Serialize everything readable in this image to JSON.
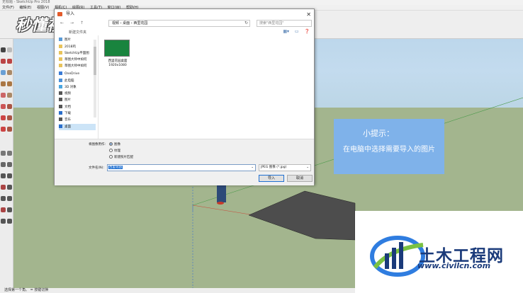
{
  "app": {
    "title": "无标题 - SketchUp Pro 2018",
    "menus": [
      "文件(F)",
      "编辑(E)",
      "视图(V)",
      "相机(C)",
      "绘图(R)",
      "工具(T)",
      "窗口(W)",
      "帮助(H)"
    ],
    "status": "选择第一个角。 = 按键切换"
  },
  "watermark": {
    "logo_text": "秒懂视频"
  },
  "dialog": {
    "title": "导入",
    "close_glyph": "✕",
    "nav": {
      "back": "←",
      "forward": "→",
      "up": "↑"
    },
    "address": "视频 › 桌面 › 西里花园",
    "search_placeholder": "搜索\"西里花园\"",
    "new_folder": "新建文件夹",
    "sidebar": [
      {
        "label": "图片",
        "icon": "pictures-icon",
        "color": "#5a9ad6"
      },
      {
        "label": "2018鸡",
        "icon": "folder-icon",
        "color": "#e8c35a"
      },
      {
        "label": "SketchUp平面图",
        "icon": "folder-icon",
        "color": "#e8c35a"
      },
      {
        "label": "草图大师中如何",
        "icon": "folder-icon",
        "color": "#e8c35a"
      },
      {
        "label": "草图大师中如何",
        "icon": "folder-icon",
        "color": "#e8c35a"
      },
      {
        "label": "OneDrive",
        "icon": "cloud-icon",
        "color": "#3a7bd5"
      },
      {
        "label": "此电脑",
        "icon": "computer-icon",
        "color": "#4a90d9"
      },
      {
        "label": "3D 对象",
        "icon": "3d-objects-icon",
        "color": "#4aa6e0"
      },
      {
        "label": "视频",
        "icon": "video-icon",
        "color": "#555555"
      },
      {
        "label": "图片",
        "icon": "pictures-icon",
        "color": "#555555"
      },
      {
        "label": "文档",
        "icon": "documents-icon",
        "color": "#555555"
      },
      {
        "label": "下载",
        "icon": "download-icon",
        "color": "#2a6ecb"
      },
      {
        "label": "音乐",
        "icon": "music-icon",
        "color": "#555555"
      },
      {
        "label": "桌面",
        "icon": "desktop-icon",
        "color": "#2a6ecb",
        "selected": true
      }
    ],
    "file": {
      "caption": "西里花园桌面\n1920x1080",
      "thumb_color": "#19843e"
    },
    "options": {
      "label": "将图像用作:",
      "radios": [
        {
          "label": "图像",
          "checked": true
        },
        {
          "label": "纹理",
          "checked": false
        },
        {
          "label": "新建照片匹配",
          "checked": false
        }
      ]
    },
    "filename_label": "文件名(N):",
    "filename_value": "西里花园",
    "filetype": "JPEG 图像 (*.jpg)",
    "import_button": "导入",
    "cancel_button": "取消"
  },
  "tip": {
    "title": "小提示：",
    "body": "在电脑中选择需要导入的图片"
  },
  "brand": {
    "name": "土木工程网",
    "url": "www.civilcn.com"
  },
  "colors": {
    "accent": "#1e6fd1",
    "tip_bg": "#7fb2ea",
    "ground": "#a3b58e",
    "brand_text": "#1a3a7a"
  }
}
